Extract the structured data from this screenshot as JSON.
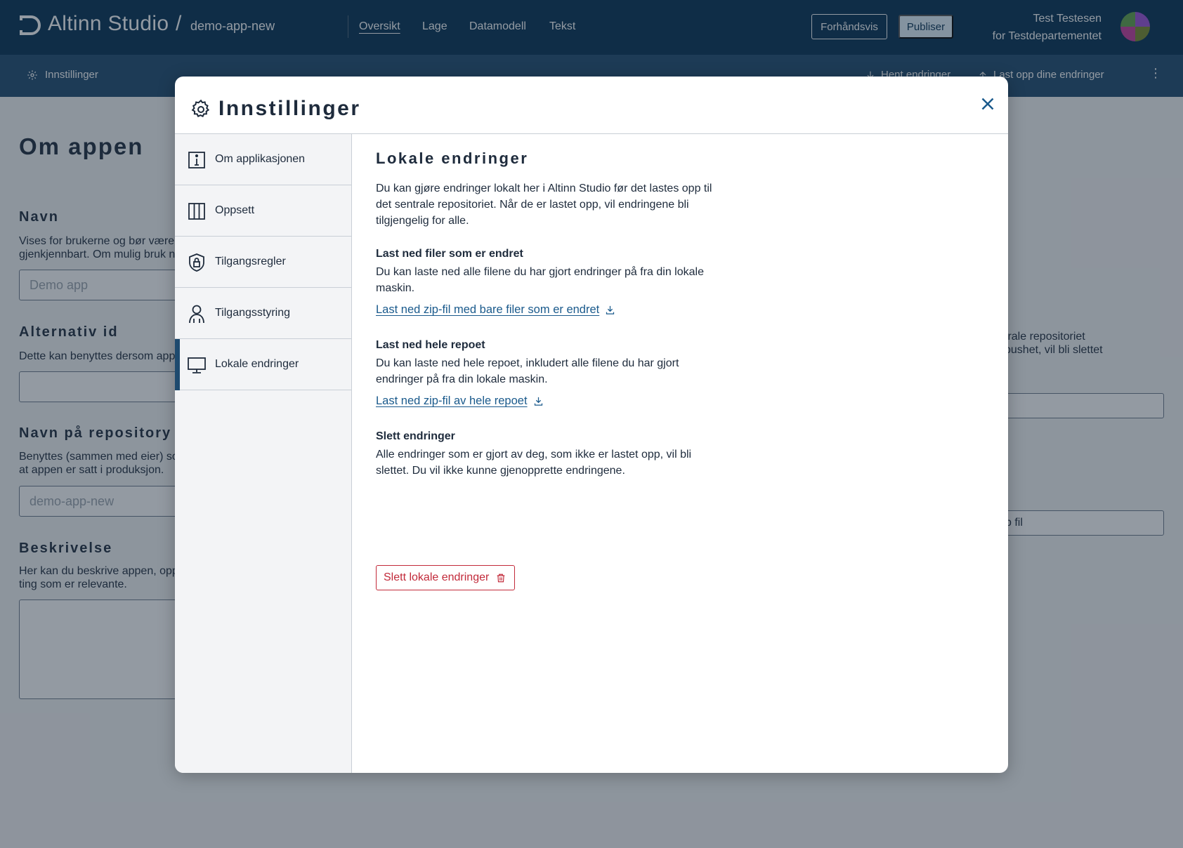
{
  "header": {
    "brand": "Altinn Studio",
    "separator": "/",
    "app_name": "demo-app-new",
    "nav": [
      "Oversikt",
      "Lage",
      "Datamodell",
      "Tekst"
    ],
    "active_nav": "Oversikt",
    "preview_label": "Forhåndsvis",
    "publish_label": "Publiser",
    "user_name": "Test Testesen",
    "user_org": "for Testdepartementet"
  },
  "subheader": {
    "settings_label": "Innstillinger",
    "fetch_label": "Hent endringer",
    "upload_label": "Last opp dine endringer"
  },
  "background": {
    "title": "Om appen",
    "name_heading": "Navn",
    "name_desc": [
      "Vises for brukerne og bør være",
      "gjenkjennbart. Om mulig bruk n"
    ],
    "name_placeholder": "Demo app",
    "altid_heading": "Alternativ id",
    "altid_desc": "Dette kan benyttes dersom app",
    "repo_heading": "Navn på repository",
    "repo_desc": [
      "Benyttes (sammen med eier) so",
      "at appen er satt i produksjon."
    ],
    "repo_placeholder": "demo-app-new",
    "desc_heading": "Beskrivelse",
    "desc_desc": [
      "Her kan du beskrive appen, opp",
      "ting som er relevante."
    ],
    "right_text": [
      "trale repositoriet",
      "pushet, vil bli slettet"
    ],
    "right_button": "p fil"
  },
  "modal": {
    "title": "Innstillinger",
    "nav_items": [
      {
        "label": "Om applikasjonen",
        "icon": "info-icon"
      },
      {
        "label": "Oppsett",
        "icon": "columns-icon"
      },
      {
        "label": "Tilgangsregler",
        "icon": "shield-lock-icon"
      },
      {
        "label": "Tilgangsstyring",
        "icon": "person-icon"
      },
      {
        "label": "Lokale endringer",
        "icon": "monitor-icon"
      }
    ],
    "active_item": "Lokale endringer",
    "content": {
      "title": "Lokale endringer",
      "intro": "Du kan gjøre endringer lokalt her i Altinn Studio før det lastes opp til det sentrale repositoriet. Når de er lastet opp, vil endringene bli tilgjengelig for alle.",
      "section1_heading": "Last ned filer som er endret",
      "section1_text": "Du kan laste ned alle filene du har gjort endringer på fra din lokale maskin.",
      "section1_link": "Last ned zip-fil med bare filer som er endret",
      "section2_heading": "Last ned hele repoet",
      "section2_text": "Du kan laste ned hele repoet, inkludert alle filene du har gjort endringer på fra din lokale maskin.",
      "section2_link": "Last ned zip-fil av hele repoet",
      "section3_heading": "Slett endringer",
      "section3_text": "Alle endringer som er gjort av deg, som ikke er lastet opp, vil bli slettet. Du vil ikke kunne gjenopprette endringene.",
      "delete_label": "Slett lokale endringer"
    }
  },
  "colors": {
    "header_bg": "#022f51",
    "subheader_bg": "#1e4a6e",
    "link": "#1a5a8c",
    "danger": "#c22a3a"
  }
}
